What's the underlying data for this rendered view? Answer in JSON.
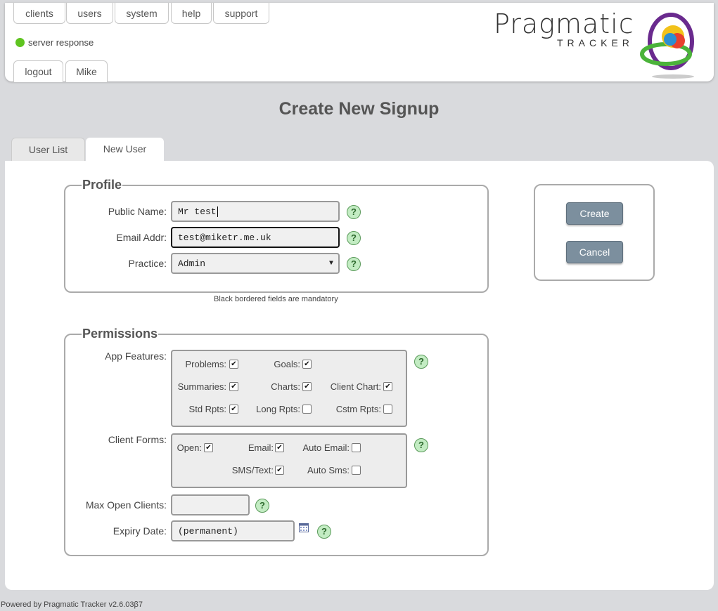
{
  "nav": {
    "top_tabs": [
      "clients",
      "users",
      "system",
      "help",
      "support"
    ],
    "status_label": "server response",
    "bottom_tabs": [
      "logout",
      "Mike"
    ]
  },
  "logo": {
    "main": "Pragmatic",
    "sub": "TRACKER"
  },
  "page_title": "Create New Signup",
  "tabs": [
    {
      "label": "User List",
      "active": false
    },
    {
      "label": "New User",
      "active": true
    }
  ],
  "profile": {
    "legend": "Profile",
    "public_name_label": "Public Name:",
    "public_name_value": "Mr test",
    "email_label": "Email Addr:",
    "email_value": "test@miketr.me.uk",
    "practice_label": "Practice:",
    "practice_value": "Admin",
    "mandatory_note": "Black bordered fields are mandatory"
  },
  "actions": {
    "create": "Create",
    "cancel": "Cancel"
  },
  "permissions": {
    "legend": "Permissions",
    "app_features_label": "App Features:",
    "app_features": [
      {
        "label": "Problems:",
        "checked": true
      },
      {
        "label": "Goals:",
        "checked": true
      },
      {
        "label": "Summaries:",
        "checked": true
      },
      {
        "label": "Charts:",
        "checked": true
      },
      {
        "label": "Client Chart:",
        "checked": true
      },
      {
        "label": "Std Rpts:",
        "checked": true
      },
      {
        "label": "Long Rpts:",
        "checked": false
      },
      {
        "label": "Cstm Rpts:",
        "checked": false
      }
    ],
    "client_forms_label": "Client Forms:",
    "client_forms": [
      {
        "label": "Open:",
        "checked": true
      },
      {
        "label": "Email:",
        "checked": true
      },
      {
        "label": "Auto Email:",
        "checked": false
      },
      {
        "label": "SMS/Text:",
        "checked": true
      },
      {
        "label": "Auto Sms:",
        "checked": false
      }
    ],
    "max_open_label": "Max Open Clients:",
    "max_open_value": "",
    "expiry_label": "Expiry Date:",
    "expiry_value": "(permanent)"
  },
  "help_symbol": "?",
  "check_symbol": "✔",
  "footer": "Powered by Pragmatic Tracker v2.6.03β7",
  "colors": {
    "status_green": "#5fc420",
    "button": "#7c8f9e",
    "help_bg": "#c3ecc3"
  }
}
